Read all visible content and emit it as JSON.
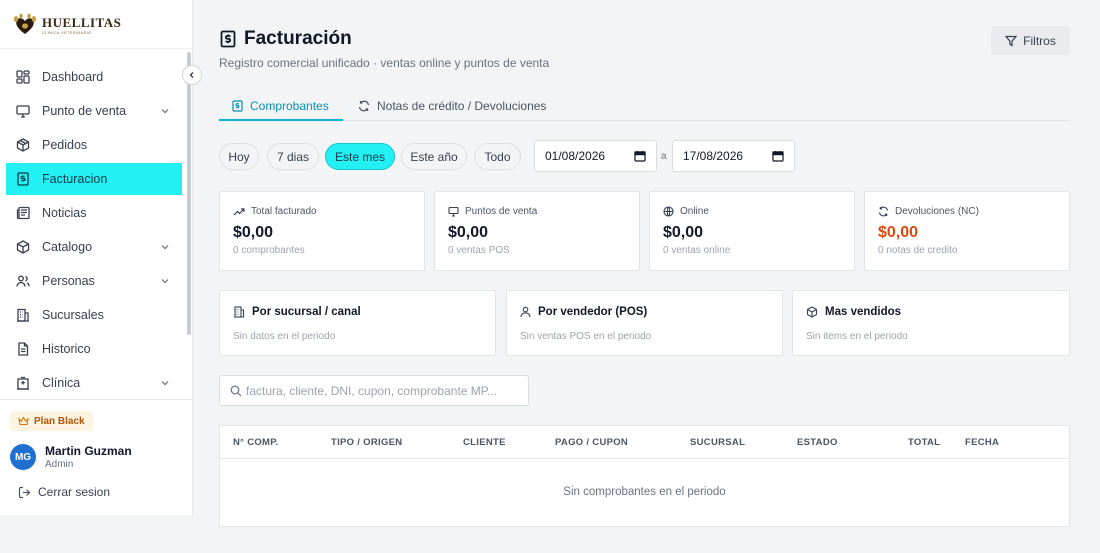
{
  "brand": {
    "name": "HUELLITAS",
    "tagline": "CLINICA VETERINARIA"
  },
  "sidebar": {
    "items": [
      {
        "label": "Dashboard",
        "icon": "dashboard-icon",
        "chevron": false
      },
      {
        "label": "Punto de venta",
        "icon": "monitor-icon",
        "chevron": true
      },
      {
        "label": "Pedidos",
        "icon": "package-icon",
        "chevron": false
      },
      {
        "label": "Facturacion",
        "icon": "invoice-icon",
        "chevron": false,
        "active": true
      },
      {
        "label": "Noticias",
        "icon": "newspaper-icon",
        "chevron": false
      },
      {
        "label": "Catalogo",
        "icon": "box-icon",
        "chevron": true
      },
      {
        "label": "Personas",
        "icon": "users-icon",
        "chevron": true
      },
      {
        "label": "Sucursales",
        "icon": "building-icon",
        "chevron": false
      },
      {
        "label": "Historico",
        "icon": "document-icon",
        "chevron": false
      },
      {
        "label": "Clínica",
        "icon": "hospital-icon",
        "chevron": true
      }
    ],
    "plan": "Plan Black",
    "user": {
      "initials": "MG",
      "name": "Martin Guzman",
      "role": "Admin"
    },
    "logout": "Cerrar sesion"
  },
  "header": {
    "title": "Facturación",
    "subtitle": "Registro comercial unificado · ventas online y puntos de venta",
    "filters_label": "Filtros"
  },
  "tabs": [
    {
      "label": "Comprobantes",
      "active": true
    },
    {
      "label": "Notas de crédito / Devoluciones",
      "active": false
    }
  ],
  "range_chips": [
    {
      "label": "Hoy",
      "active": false
    },
    {
      "label": "7 dias",
      "active": false
    },
    {
      "label": "Este mes",
      "active": true
    },
    {
      "label": "Este año",
      "active": false
    },
    {
      "label": "Todo",
      "active": false
    }
  ],
  "date_range": {
    "from": "01/08/2026",
    "separator": "a",
    "to": "17/08/2026"
  },
  "stats": [
    {
      "label": "Total facturado",
      "value": "$0,00",
      "sub": "0 comprobantes",
      "icon": "trend-up-icon"
    },
    {
      "label": "Puntos de venta",
      "value": "$0,00",
      "sub": "0 ventas POS",
      "icon": "monitor-icon"
    },
    {
      "label": "Online",
      "value": "$0,00",
      "sub": "0 ventas online",
      "icon": "globe-icon"
    },
    {
      "label": "Devoluciones (NC)",
      "value": "$0,00",
      "sub": "0 notas de credito",
      "icon": "refresh-icon",
      "accent": "#dc4a0f"
    }
  ],
  "panels": [
    {
      "title": "Por sucursal / canal",
      "sub": "Sin datos en el periodo",
      "icon": "building-icon"
    },
    {
      "title": "Por vendedor (POS)",
      "sub": "Sin ventas POS en el periodo",
      "icon": "user-icon"
    },
    {
      "title": "Mas vendidos",
      "sub": "Sin items en el periodo",
      "icon": "box-icon"
    }
  ],
  "search": {
    "placeholder": "factura, cliente, DNI, cupon, comprobante MP..."
  },
  "table": {
    "columns": [
      "N° COMP.",
      "TIPO / ORIGEN",
      "CLIENTE",
      "PAGO / CUPON",
      "SUCURSAL",
      "ESTADO",
      "TOTAL",
      "FECHA"
    ],
    "empty": "Sin comprobantes en el periodo"
  },
  "colors": {
    "accent": "#22f0f3",
    "tab_active": "#0891b2",
    "refund": "#dc4a0f",
    "avatar": "#1e6fd0"
  }
}
